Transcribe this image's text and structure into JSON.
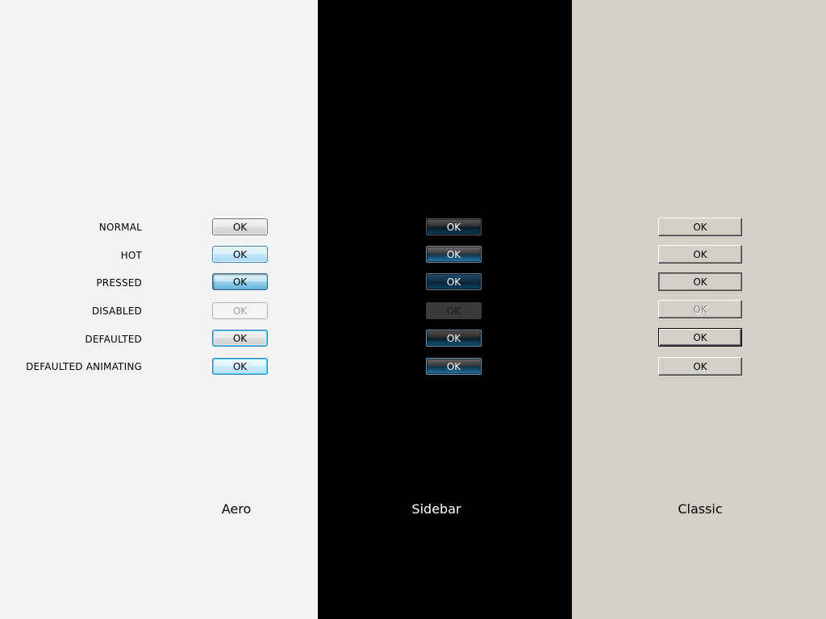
{
  "rows": [
    {
      "state": "NORMAL"
    },
    {
      "state": "HOT"
    },
    {
      "state": "PRESSED"
    },
    {
      "state": "DISABLED"
    },
    {
      "state": "DEFAULTED"
    },
    {
      "state": "DEFAULTED ANIMATING"
    }
  ],
  "button_label": "OK",
  "themes": {
    "aero": {
      "label": "Aero",
      "background": "#f3f3f3"
    },
    "sidebar": {
      "label": "Sidebar",
      "background": "#000000"
    },
    "classic": {
      "label": "Classic",
      "background": "#d4d0c8"
    }
  }
}
